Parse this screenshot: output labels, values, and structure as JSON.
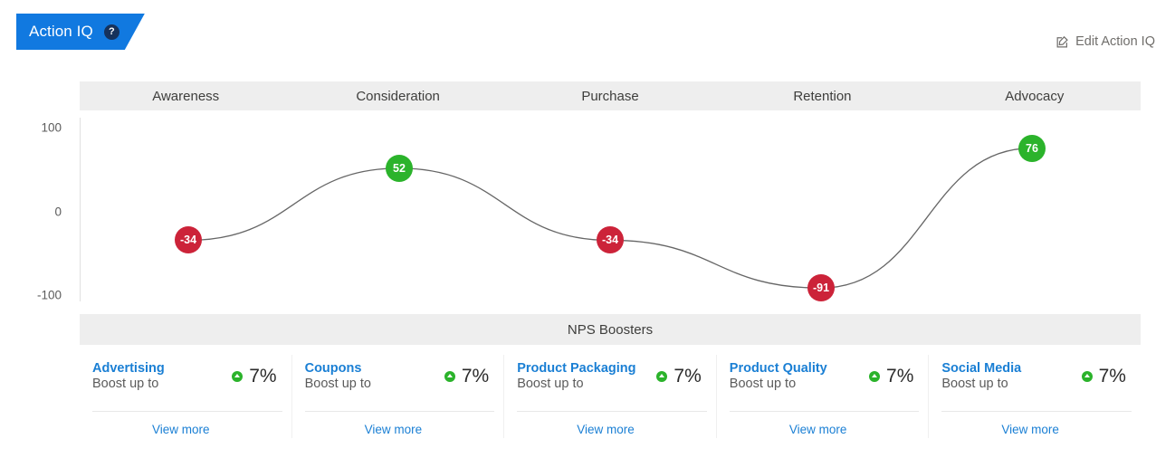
{
  "header": {
    "tab_label": "Action IQ",
    "help_icon": "question-mark-icon",
    "edit_label": "Edit Action IQ",
    "edit_icon": "edit-pencil-square-icon"
  },
  "colors": {
    "brand_blue": "#1179e0",
    "link_blue": "#1a7fd4",
    "positive_green": "#2bb32b",
    "negative_red": "#cc2339",
    "header_gray": "#eeeeee"
  },
  "chart_data": {
    "type": "line",
    "title": "",
    "xlabel": "",
    "ylabel": "",
    "categories": [
      "Awareness",
      "Consideration",
      "Purchase",
      "Retention",
      "Advocacy"
    ],
    "values": [
      -34,
      52,
      -34,
      -91,
      76
    ],
    "point_labels": [
      "-34",
      "52",
      "-34",
      "-91",
      "76"
    ],
    "point_colors": [
      "#cc2339",
      "#2bb32b",
      "#cc2339",
      "#cc2339",
      "#2bb32b"
    ],
    "yticks": [
      100,
      0,
      -100
    ],
    "ytick_labels": [
      "100",
      "0",
      "-100"
    ],
    "ylim": [
      -130,
      130
    ],
    "grid": false,
    "legend": "none",
    "line_color": "#666666",
    "curve": "smooth"
  },
  "nps": {
    "section_title": "NPS Boosters",
    "boost_label": "Boost up to",
    "view_more_label": "View more",
    "arrow_icon": "arrow-up-circle-icon",
    "boosters": [
      {
        "name": "Advertising",
        "boost_label": "Boost up to",
        "value": "7%",
        "view_more": "View more"
      },
      {
        "name": "Coupons",
        "boost_label": "Boost up to",
        "value": "7%",
        "view_more": "View more"
      },
      {
        "name": "Product Packaging",
        "boost_label": "Boost up to",
        "value": "7%",
        "view_more": "View more"
      },
      {
        "name": "Product Quality",
        "boost_label": "Boost up to",
        "value": "7%",
        "view_more": "View more"
      },
      {
        "name": "Social Media",
        "boost_label": "Boost up to",
        "value": "7%",
        "view_more": "View more"
      }
    ]
  }
}
